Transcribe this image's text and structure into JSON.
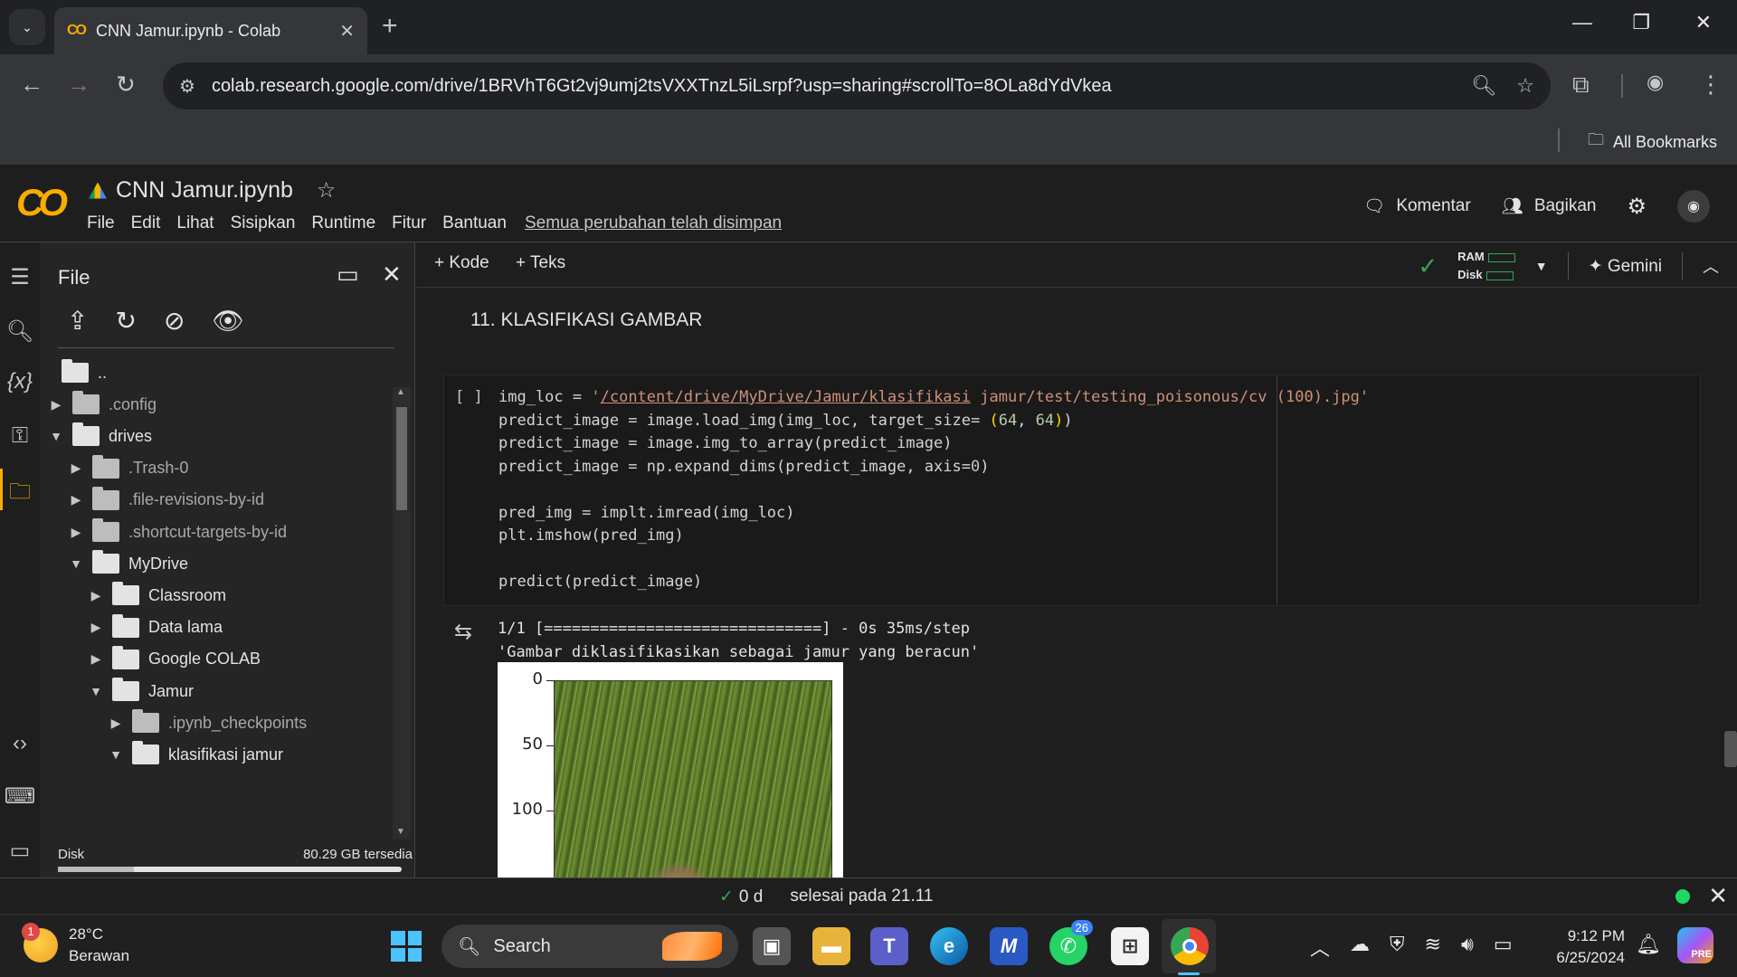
{
  "browser": {
    "tab_title": "CNN Jamur.ipynb - Colab",
    "url": "colab.research.google.com/drive/1BRVhT6Gt2vj9umj2tsVXXTnzL5iLsrpf?usp=sharing#scrollTo=8OLa8dYdVkea",
    "all_bookmarks": "All Bookmarks"
  },
  "colab": {
    "notebook_name": "CNN Jamur.ipynb",
    "menu": [
      "File",
      "Edit",
      "Lihat",
      "Sisipkan",
      "Runtime",
      "Fitur",
      "Bantuan"
    ],
    "saved_status": "Semua perubahan telah disimpan",
    "comment_label": "Komentar",
    "share_label": "Bagikan"
  },
  "files_panel": {
    "title": "File",
    "tree": [
      {
        "label": "..",
        "depth": 0,
        "arrow": "",
        "dim": false
      },
      {
        "label": ".config",
        "depth": 0,
        "arrow": "right",
        "dim": true
      },
      {
        "label": "drives",
        "depth": 0,
        "arrow": "down",
        "dim": false
      },
      {
        "label": ".Trash-0",
        "depth": 1,
        "arrow": "right",
        "dim": true
      },
      {
        "label": ".file-revisions-by-id",
        "depth": 1,
        "arrow": "right",
        "dim": true
      },
      {
        "label": ".shortcut-targets-by-id",
        "depth": 1,
        "arrow": "right",
        "dim": true
      },
      {
        "label": "MyDrive",
        "depth": 1,
        "arrow": "down",
        "dim": false
      },
      {
        "label": "Classroom",
        "depth": 2,
        "arrow": "right",
        "dim": false
      },
      {
        "label": "Data lama",
        "depth": 2,
        "arrow": "right",
        "dim": false
      },
      {
        "label": "Google COLAB",
        "depth": 2,
        "arrow": "right",
        "dim": false
      },
      {
        "label": "Jamur",
        "depth": 2,
        "arrow": "down",
        "dim": false
      },
      {
        "label": ".ipynb_checkpoints",
        "depth": 3,
        "arrow": "right",
        "dim": true
      },
      {
        "label": "klasifikasi jamur",
        "depth": 3,
        "arrow": "down",
        "dim": false
      }
    ],
    "disk_label": "Disk",
    "disk_free": "80.29 GB tersedia",
    "disk_used_fraction": 0.22
  },
  "toolbar": {
    "add_code": "Kode",
    "add_text": "Teks",
    "ram_label": "RAM",
    "disk_label": "Disk",
    "gemini_label": "Gemini"
  },
  "notebook": {
    "section_heading": "11. KLASIFIKASI GAMBAR",
    "cell_bracket": "[ ]",
    "output_line1": "1/1 [==============================] - 0s 35ms/step",
    "output_line2": "'Gambar diklasifikasikan sebagai jamur yang beracun'",
    "plot_ticks": [
      "0",
      "50",
      "100"
    ]
  },
  "status_bar": {
    "duration": "0 d",
    "finished": "selesai pada 21.11"
  },
  "taskbar": {
    "temperature": "28°C",
    "weather": "Berawan",
    "weather_badge": "1",
    "search_label": "Search",
    "whatsapp_count": "26",
    "time": "9:12 PM",
    "date": "6/25/2024",
    "copilot_badge": "PRE"
  }
}
